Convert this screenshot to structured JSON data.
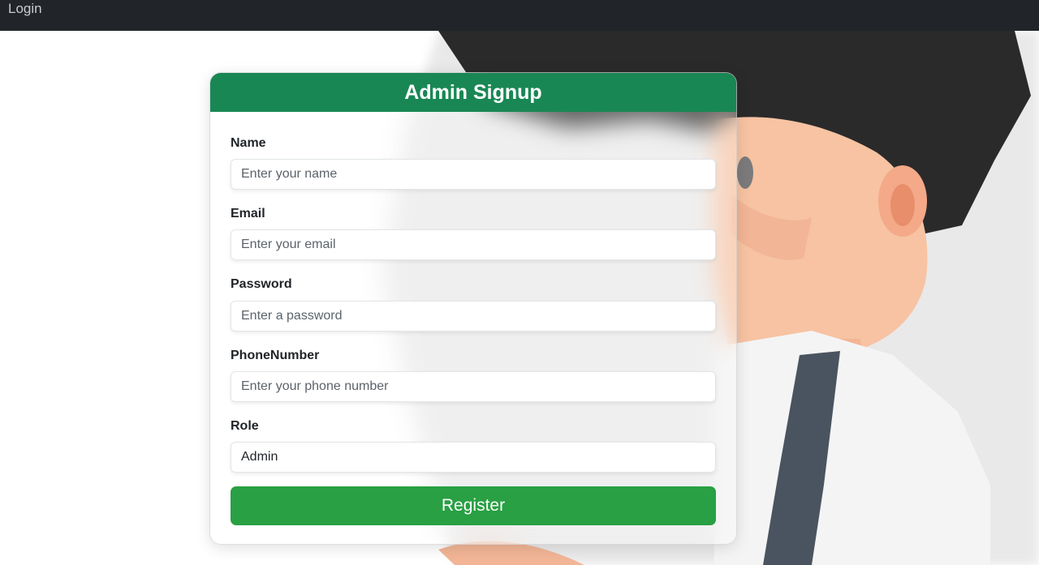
{
  "navbar": {
    "login_link": "Login"
  },
  "form": {
    "title": "Admin Signup",
    "fields": [
      {
        "label": "Name",
        "placeholder": "Enter your name"
      },
      {
        "label": "Email",
        "placeholder": "Enter your email"
      },
      {
        "label": "Password",
        "placeholder": "Enter a password"
      },
      {
        "label": "PhoneNumber",
        "placeholder": "Enter your phone number"
      }
    ],
    "role": {
      "label": "Role",
      "value": "Admin"
    },
    "submit_label": "Register"
  },
  "colors": {
    "navbar": "#212529",
    "header": "#198754",
    "button": "#28a043"
  }
}
